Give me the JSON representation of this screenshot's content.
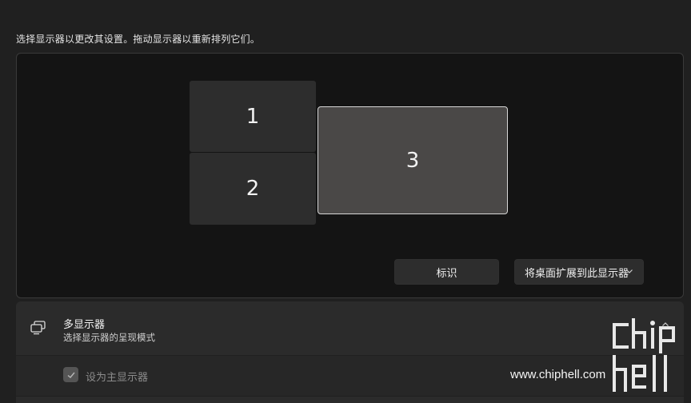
{
  "instruction": "选择显示器以更改其设置。拖动显示器以重新排列它们。",
  "monitors": [
    {
      "label": "1",
      "selected": false
    },
    {
      "label": "2",
      "selected": false
    },
    {
      "label": "3",
      "selected": true
    }
  ],
  "buttons": {
    "identify": "标识",
    "extend": "将桌面扩展到此显示器"
  },
  "multi_display": {
    "title": "多显示器",
    "subtitle": "选择显示器的呈现模式",
    "icon": "multi-monitor-icon",
    "expanded": true
  },
  "primary_display": {
    "label": "设为主显示器",
    "checked": true,
    "enabled": false
  },
  "watermark": {
    "logo_text": "chiphell",
    "url": "www.chiphell.com"
  }
}
